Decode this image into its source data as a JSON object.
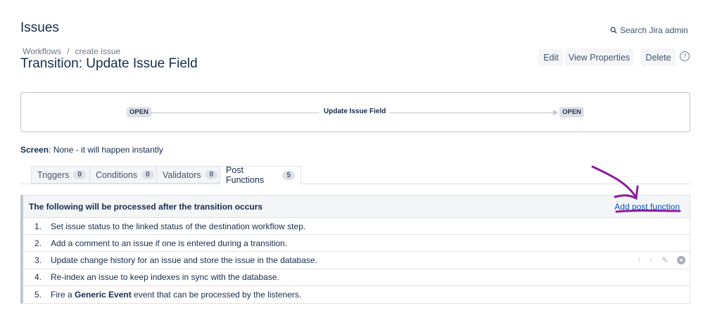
{
  "header": {
    "section_title": "Issues",
    "search_label": "Search Jira admin",
    "search_icon": "search-icon"
  },
  "breadcrumb": {
    "items": [
      "Workflows",
      "create issue"
    ],
    "separator": "/"
  },
  "page_title": "Transition: Update Issue Field",
  "actions": {
    "edit": "Edit",
    "view_properties": "View Properties",
    "delete": "Delete",
    "help": "?"
  },
  "diagram": {
    "from": "OPEN",
    "transition": "Update Issue Field",
    "to": "OPEN"
  },
  "screen": {
    "label": "Screen",
    "value": ": None - it will happen instantly"
  },
  "tabs": [
    {
      "label": "Triggers",
      "count": "0"
    },
    {
      "label": "Conditions",
      "count": "0"
    },
    {
      "label": "Validators",
      "count": "0"
    },
    {
      "label": "Post Functions",
      "count": "5"
    }
  ],
  "post_functions": {
    "header": "The following will be processed after the transition occurs",
    "add_link": "Add post function",
    "items": [
      {
        "num": "1.",
        "text": "Set issue status to the linked status of the destination workflow step."
      },
      {
        "num": "2.",
        "text": "Add a comment to an issue if one is entered during a transition."
      },
      {
        "num": "3.",
        "text": "Update change history for an issue and store the issue in the database."
      },
      {
        "num": "4.",
        "text": "Re-index an issue to keep indexes in sync with the database."
      },
      {
        "num": "5.",
        "pre": "Fire a ",
        "bold": "Generic Event",
        "post": " event that can be processed by the listeners."
      }
    ]
  },
  "annotation_color": "#8b1a9e"
}
